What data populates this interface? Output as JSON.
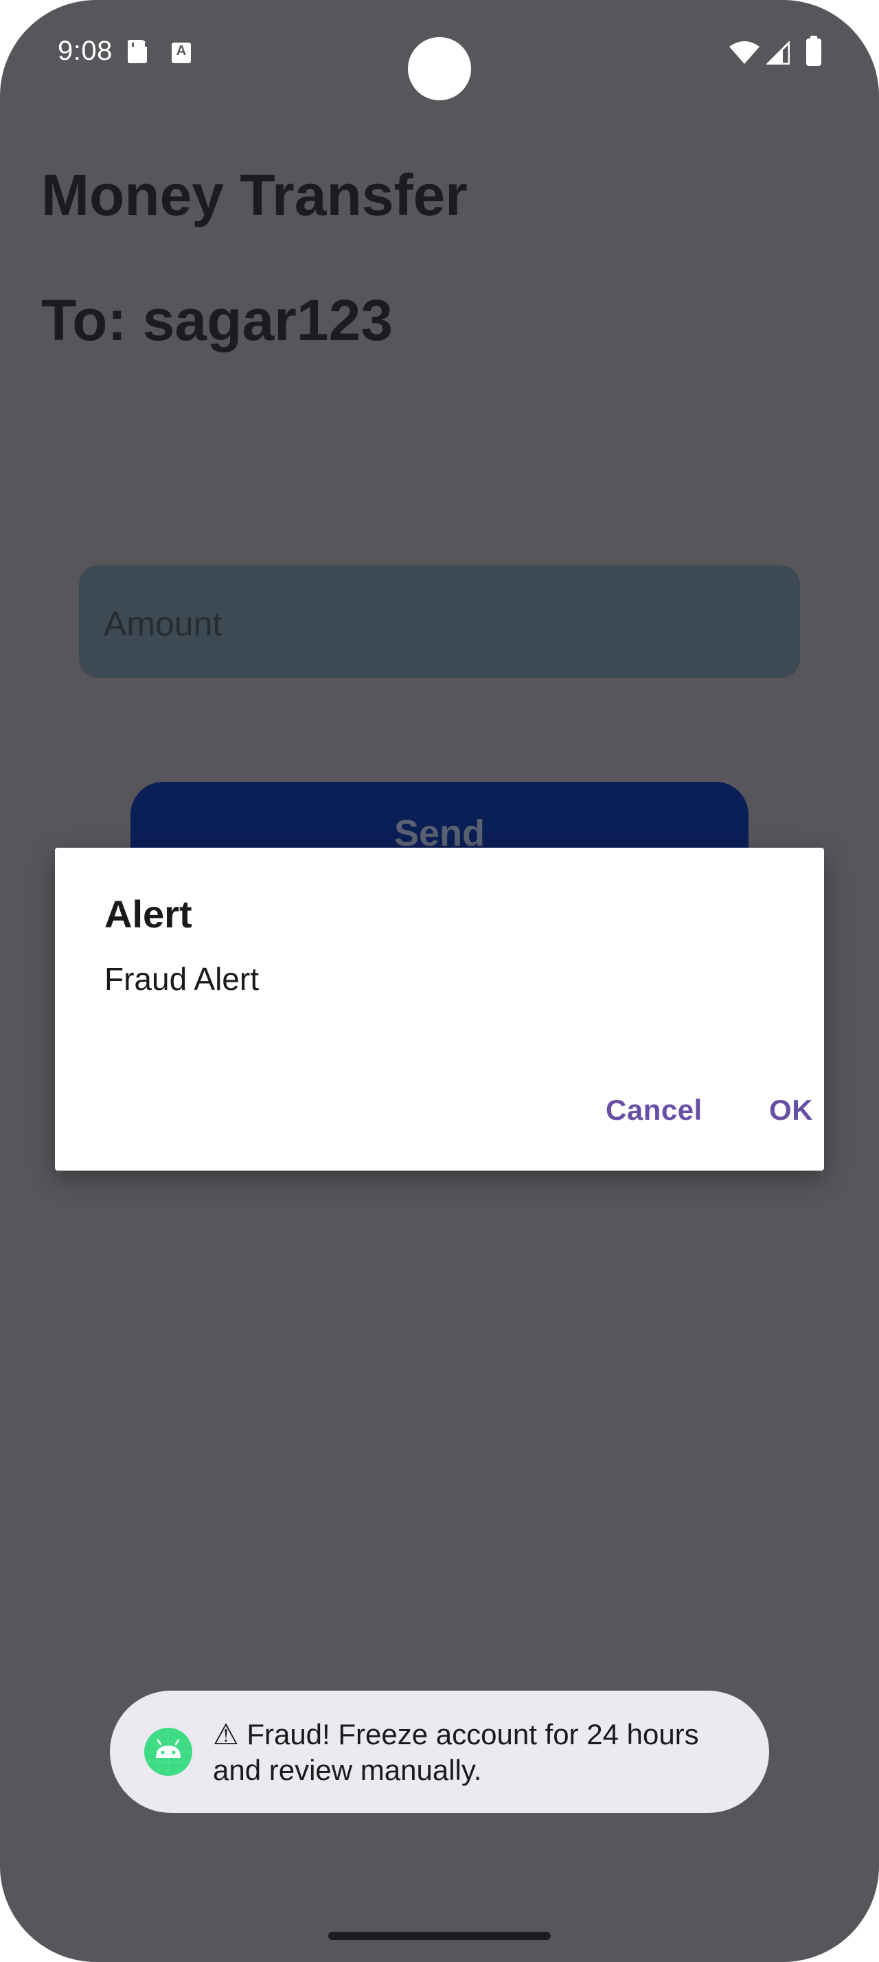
{
  "status_bar": {
    "time": "9:08",
    "icons": [
      "sd-card-icon",
      "keyboard-a-icon",
      "wifi-icon",
      "cell-signal-icon",
      "battery-icon"
    ]
  },
  "screen": {
    "title": "Money Transfer",
    "recipient": "To: sagar123",
    "amount_placeholder": "Amount",
    "send_label": "Send"
  },
  "dialog": {
    "title": "Alert",
    "message": "Fraud Alert",
    "cancel_label": "Cancel",
    "ok_label": "OK",
    "button_color": "#6750a4"
  },
  "toast": {
    "icon": "android-icon",
    "message": "⚠ Fraud! Freeze account for 24 hours and review manually."
  },
  "colors": {
    "scrim": "#58565a",
    "send_button": "#0b1f57",
    "android_green": "#3ddc84"
  }
}
